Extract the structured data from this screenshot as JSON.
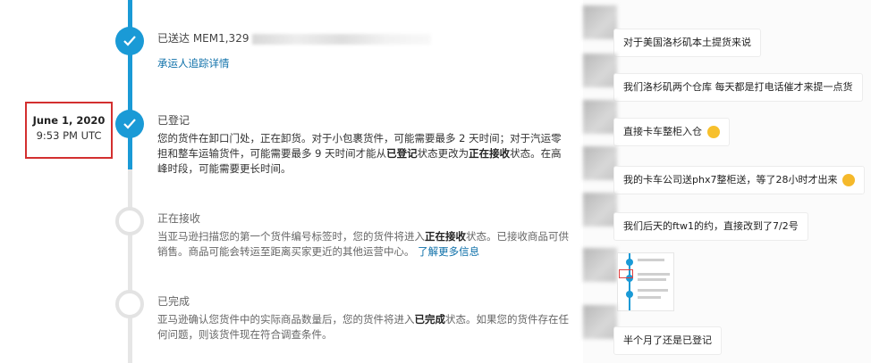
{
  "timeline": {
    "date_box": {
      "date": "June 1, 2020",
      "time": "9:53 PM UTC"
    },
    "steps": [
      {
        "title": "已送达 MEM1,329",
        "link": "承运人追踪详情"
      },
      {
        "title": "已登记",
        "body_1": "您的货件在卸口门处，正在卸货。对于小包裹货件，可能需要最多 2 天时间；对于汽运零担和整车运输货件，可能需要最多 9 天时间才能从",
        "body_bold_1": "已登记",
        "body_2": "状态更改为",
        "body_bold_2": "正在接收",
        "body_3": "状态。在高峰时段，可能需要更长时间。"
      },
      {
        "title": "正在接收",
        "body_1": "当亚马逊扫描您的第一个货件编号标签时，您的货件将进入",
        "body_bold_1": "正在接收",
        "body_2": "状态。已接收商品可供销售。商品可能会转运至距离买家更近的其他运营中心。",
        "link": "了解更多信息"
      },
      {
        "title": "已完成",
        "body_1": "亚马逊确认您货件中的实际商品数量后，您的货件将进入",
        "body_bold_1": "已完成",
        "body_2": "状态。如果您的货件存在任何问题，则该货件现在符合调查条件。"
      }
    ]
  },
  "chat": {
    "messages": [
      {
        "text": "对于美国洛杉矶本土提货来说"
      },
      {
        "text": "我们洛杉矶两个仓库  每天都是打电话催才来提一点货"
      },
      {
        "text": "直接卡车整柜入仓"
      },
      {
        "text": "我的卡车公司送phx7整柜送，等了28小时才出来"
      },
      {
        "text": "我们后天的ftw1的约，直接改到了7/2号"
      },
      {
        "text": "半个月了还是已登记"
      }
    ]
  },
  "colors": {
    "accent": "#1a9ad6",
    "highlight_border": "#d32f2f",
    "link": "#0b6ea8"
  }
}
